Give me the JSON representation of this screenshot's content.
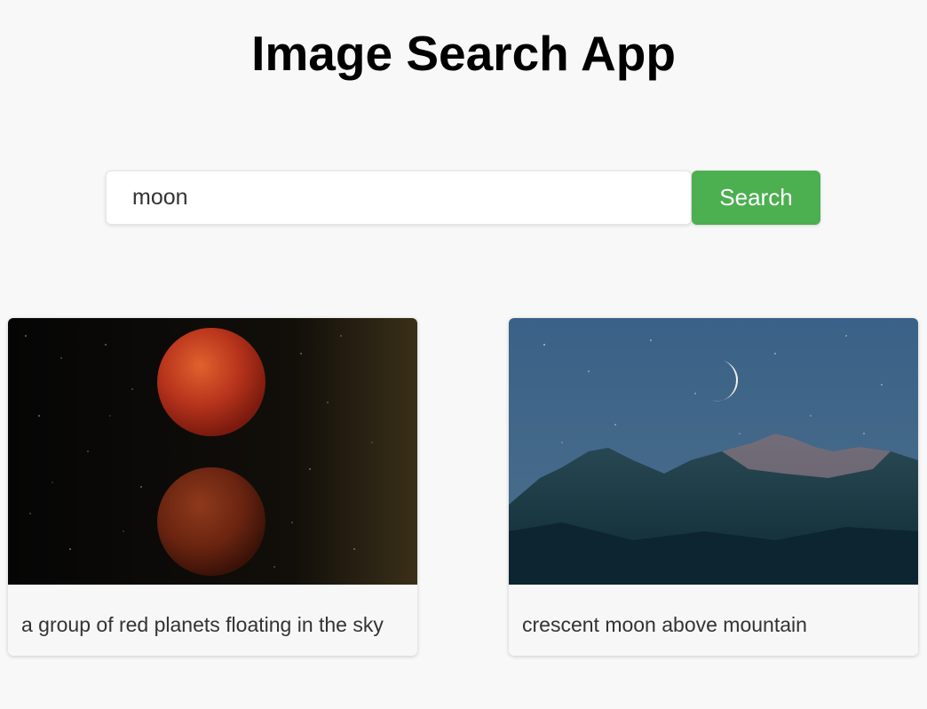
{
  "header": {
    "title": "Image Search App"
  },
  "search": {
    "value": "moon",
    "button_label": "Search"
  },
  "results": [
    {
      "caption": "a group of red planets floating in the sky",
      "image": "red-planets-photo"
    },
    {
      "caption": "crescent moon above mountain",
      "image": "crescent-moon-mountain-photo"
    }
  ],
  "colors": {
    "accent": "#4caf50",
    "background": "#f8f8f8"
  }
}
